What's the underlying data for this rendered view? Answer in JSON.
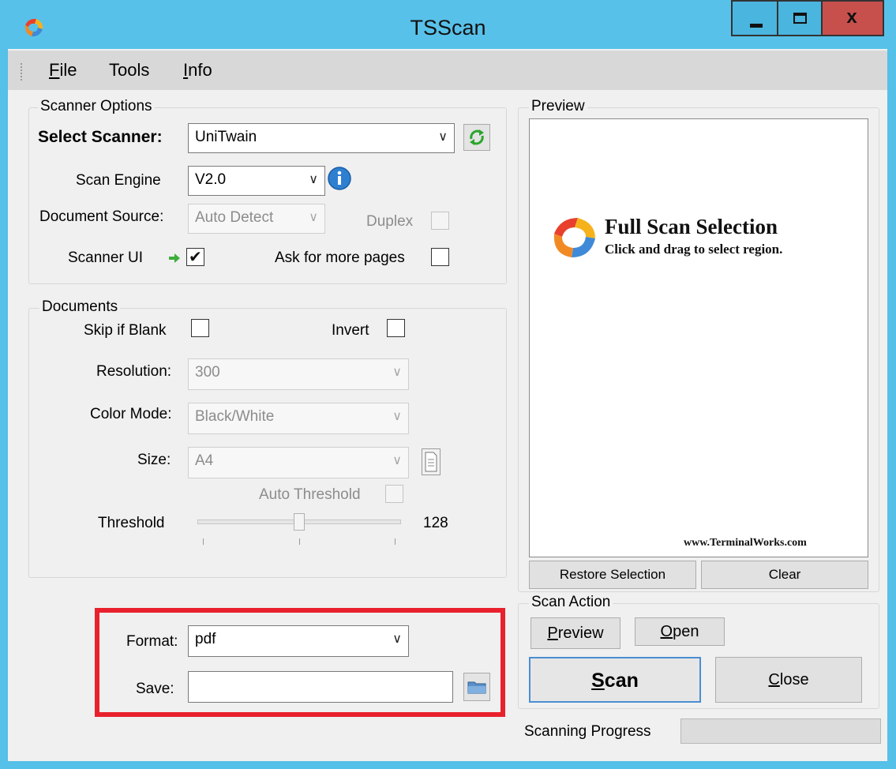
{
  "window": {
    "title": "TSScan",
    "controls": {
      "minimize": "minimize-icon",
      "maximize": "maximize-icon",
      "close": "x"
    }
  },
  "menu": {
    "file": "File",
    "tools": "Tools",
    "info": "Info"
  },
  "scanner_options": {
    "legend": "Scanner Options",
    "select_scanner_label": "Select Scanner:",
    "select_scanner_value": "UniTwain",
    "scan_engine_label": "Scan Engine",
    "scan_engine_value": "V2.0",
    "document_source_label": "Document Source:",
    "document_source_value": "Auto Detect",
    "duplex_label": "Duplex",
    "scanner_ui_label": "Scanner UI",
    "scanner_ui_checked": true,
    "ask_more_pages_label": "Ask for more pages"
  },
  "documents": {
    "legend": "Documents",
    "skip_blank_label": "Skip if Blank",
    "invert_label": "Invert",
    "resolution_label": "Resolution:",
    "resolution_value": "300",
    "color_mode_label": "Color Mode:",
    "color_mode_value": "Black/White",
    "size_label": "Size:",
    "size_value": "A4",
    "auto_threshold_label": "Auto Threshold",
    "threshold_label": "Threshold",
    "threshold_value": "128",
    "threshold_level": 0.5,
    "format_label": "Format:",
    "format_value": "pdf",
    "save_label": "Save:",
    "save_value": ""
  },
  "preview": {
    "legend": "Preview",
    "overlay_title": "Full Scan Selection",
    "overlay_subtitle": "Click and drag to select region.",
    "watermark": "www.TerminalWorks.com",
    "restore_button": "Restore Selection",
    "clear_button": "Clear"
  },
  "scan_action": {
    "legend": "Scan Action",
    "preview_button": "Preview",
    "open_button": "Open",
    "scan_button": "Scan",
    "close_button": "Close"
  },
  "progress": {
    "label": "Scanning Progress",
    "value": 0
  },
  "colors": {
    "titlebar": "#58c1e9",
    "close": "#c7504d",
    "highlight": "#e8212c",
    "window_bg": "#f0f0f0"
  }
}
